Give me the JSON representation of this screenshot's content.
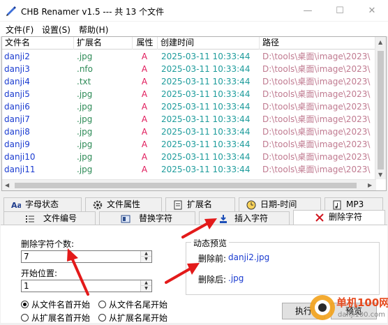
{
  "window": {
    "title": "CHB Renamer v1.5 --- 共 13 个文件",
    "minimize": "—",
    "maximize": "☐",
    "close": "✕"
  },
  "menu": {
    "file": "文件(F)",
    "settings": "设置(S)",
    "help": "帮助(H)"
  },
  "list": {
    "columns": {
      "name": "文件名",
      "ext": "扩展名",
      "attr": "属性",
      "created": "创建时间",
      "path": "路径"
    },
    "rows": [
      {
        "name": "danji2",
        "ext": ".jpg",
        "attr": "A",
        "created": "2025-03-11 10:33:44",
        "path": "D:\\tools\\桌面\\image\\2023\\"
      },
      {
        "name": "danji3",
        "ext": ".nfo",
        "attr": "A",
        "created": "2025-03-11 10:33:44",
        "path": "D:\\tools\\桌面\\image\\2023\\"
      },
      {
        "name": "danji4",
        "ext": ".txt",
        "attr": "A",
        "created": "2025-03-11 10:33:44",
        "path": "D:\\tools\\桌面\\image\\2023\\"
      },
      {
        "name": "danji5",
        "ext": ".jpg",
        "attr": "A",
        "created": "2025-03-11 10:33:44",
        "path": "D:\\tools\\桌面\\image\\2023\\"
      },
      {
        "name": "danji6",
        "ext": ".jpg",
        "attr": "A",
        "created": "2025-03-11 10:33:44",
        "path": "D:\\tools\\桌面\\image\\2023\\"
      },
      {
        "name": "danji7",
        "ext": ".jpg",
        "attr": "A",
        "created": "2025-03-11 10:33:44",
        "path": "D:\\tools\\桌面\\image\\2023\\"
      },
      {
        "name": "danji8",
        "ext": ".jpg",
        "attr": "A",
        "created": "2025-03-11 10:33:44",
        "path": "D:\\tools\\桌面\\image\\2023\\"
      },
      {
        "name": "danji9",
        "ext": ".jpg",
        "attr": "A",
        "created": "2025-03-11 10:33:44",
        "path": "D:\\tools\\桌面\\image\\2023\\"
      },
      {
        "name": "danji10",
        "ext": ".jpg",
        "attr": "A",
        "created": "2025-03-11 10:33:44",
        "path": "D:\\tools\\桌面\\image\\2023\\"
      },
      {
        "name": "danji11",
        "ext": ".jpg",
        "attr": "A",
        "created": "2025-03-11 10:33:44",
        "path": "D:\\tools\\桌面\\image\\2023\\"
      }
    ]
  },
  "tabs_row1": [
    {
      "label": "字母状态",
      "icon": "letter-case-icon"
    },
    {
      "label": "文件属性",
      "icon": "gear-icon"
    },
    {
      "label": "扩展名",
      "icon": "document-icon"
    },
    {
      "label": "日期-时间",
      "icon": "clock-icon"
    },
    {
      "label": "MP3",
      "icon": "music-file-icon"
    }
  ],
  "tabs_row2": [
    {
      "label": "文件编号",
      "icon": "numbered-list-icon"
    },
    {
      "label": "替换字符",
      "icon": "replace-icon"
    },
    {
      "label": "插入字符",
      "icon": "insert-icon"
    },
    {
      "label": "删除字符",
      "icon": "delete-x-icon",
      "active": true
    }
  ],
  "delete_panel": {
    "count_label": "删除字符个数:",
    "count_value": "7",
    "start_label": "开始位置:",
    "start_value": "1",
    "radios": [
      {
        "label": "从文件名首开始",
        "checked": true
      },
      {
        "label": "从文件名尾开始",
        "checked": false
      },
      {
        "label": "从扩展名首开始",
        "checked": false
      },
      {
        "label": "从扩展名尾开始",
        "checked": false
      }
    ],
    "preview": {
      "title": "动态预览",
      "before_label": "删除前:",
      "before_value": "danji2.jpg",
      "after_label": "删除后:",
      "after_value": ".jpg"
    },
    "execute_button": "执行",
    "preview_button": "预览"
  },
  "watermark": {
    "text": "单机100网",
    "url_text": "danji100.com"
  },
  "colors": {
    "name": "#1a3bd0",
    "ext": "#2e8b57",
    "attr": "#e0185a",
    "date": "#1e9c9c",
    "path": "#c07a90",
    "annotation_arrow": "#e31a1a"
  }
}
